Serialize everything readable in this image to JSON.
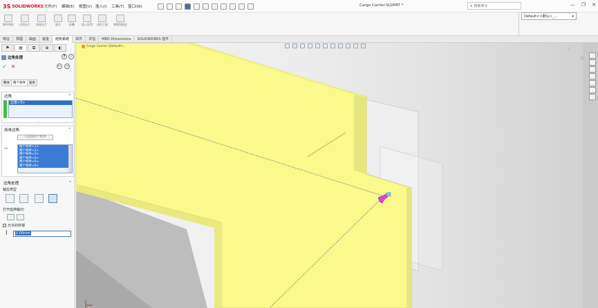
{
  "app": {
    "logo_text": "SOLIDWORKS",
    "doc_title": "Cargo Carrier.SLDPRT *",
    "menus": [
      "文件(F)",
      "编辑(E)",
      "视图(V)",
      "插入(I)",
      "工具(T)",
      "窗口(W)"
    ],
    "search_placeholder": "搜索命令",
    "window_controls": [
      "—",
      "❐",
      "✕"
    ]
  },
  "ribbon": {
    "buttons": [
      {
        "label": "焊件特征"
      },
      {
        "label": "边线法兰"
      },
      {
        "label": "斜接法兰"
      },
      {
        "label": "展开"
      },
      {
        "label": "折叠"
      },
      {
        "label": "插入折弯"
      },
      {
        "label": "成形工具"
      },
      {
        "label": "转换到钣金"
      }
    ],
    "config_value": "Default<<默认>_..."
  },
  "command_tabs": [
    {
      "label": "特征",
      "active": false
    },
    {
      "label": "草图",
      "active": false
    },
    {
      "label": "曲面",
      "active": false
    },
    {
      "label": "钣金",
      "active": false
    },
    {
      "label": "结构系统",
      "active": true
    },
    {
      "label": "焊件",
      "active": false
    },
    {
      "label": "评估",
      "active": false
    },
    {
      "label": "MBD Dimensions",
      "active": false
    },
    {
      "label": "SOLIDWORKS 插件",
      "active": false
    }
  ],
  "property_manager": {
    "title": "边角处理",
    "help_label": "?",
    "subtabs": [
      {
        "label": "整体",
        "active": false
      },
      {
        "label": "两个构件",
        "active": true
      },
      {
        "label": "复杂",
        "active": false
      }
    ],
    "corner_group": {
      "title": "边角",
      "selection": "边角<5>"
    },
    "member_group": {
      "title": "简单边角",
      "button_label": "只选择单个构件",
      "members": [
        "两个构件<1>",
        "两个构件<2>",
        "两个构件<3>",
        "两个构件<4>",
        "两个构件<5>",
        "两个构件<6>"
      ]
    },
    "treatment_group": {
      "title": "边角处理",
      "type_label": "裁剪类型",
      "trim_label": "打开延伸裁切:",
      "gap_label": "允许的终端",
      "gap_value": "0.00mm"
    }
  },
  "viewport": {
    "doc_tab_label": "Cargo Carrier (Default<...",
    "colors": {
      "body": "#f9f98c",
      "body_shade": "#e6e67e",
      "body_edge": "#c8c861",
      "arrow": "#e83ee0"
    }
  }
}
